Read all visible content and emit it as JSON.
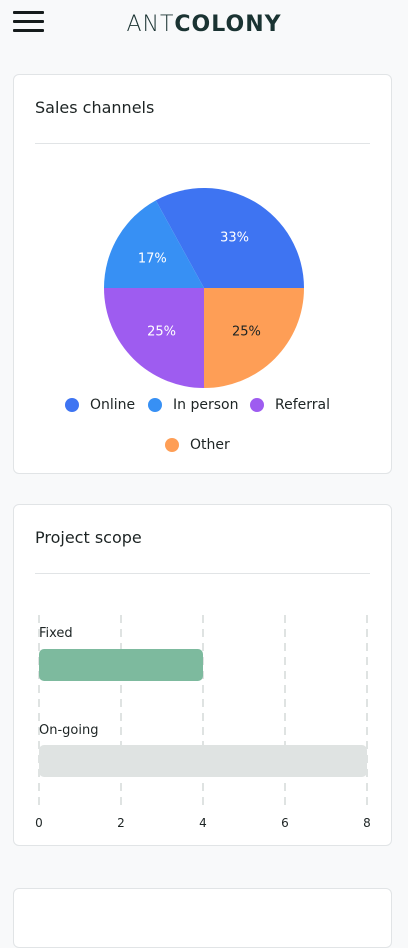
{
  "header": {
    "menu_icon": "hamburger-menu-icon",
    "logo_light": "ANT",
    "logo_bold": "COLONY"
  },
  "sales_channels": {
    "title": "Sales channels",
    "chart_data": {
      "type": "pie",
      "slices": [
        {
          "name": "Online",
          "value": 33,
          "label": "33%",
          "color": "#3e74f2"
        },
        {
          "name": "In person",
          "value": 17,
          "label": "17%",
          "color": "#3790f4"
        },
        {
          "name": "Referral",
          "value": 25,
          "label": "25%",
          "color": "#9e5cf0"
        },
        {
          "name": "Other",
          "value": 25,
          "label": "25%",
          "color": "#fe9e56"
        }
      ],
      "legend_placement": "bottom"
    }
  },
  "project_scope": {
    "title": "Project scope",
    "chart_data": {
      "type": "bar",
      "orientation": "horizontal",
      "categories": [
        "Fixed",
        "On-going"
      ],
      "values": [
        4,
        8
      ],
      "colors": [
        "#7dba9e",
        "#dfe3e2"
      ],
      "xlim": [
        0,
        8
      ],
      "xticks": [
        "0",
        "2",
        "4",
        "6",
        "8"
      ],
      "grid": "dashed vertical"
    }
  }
}
